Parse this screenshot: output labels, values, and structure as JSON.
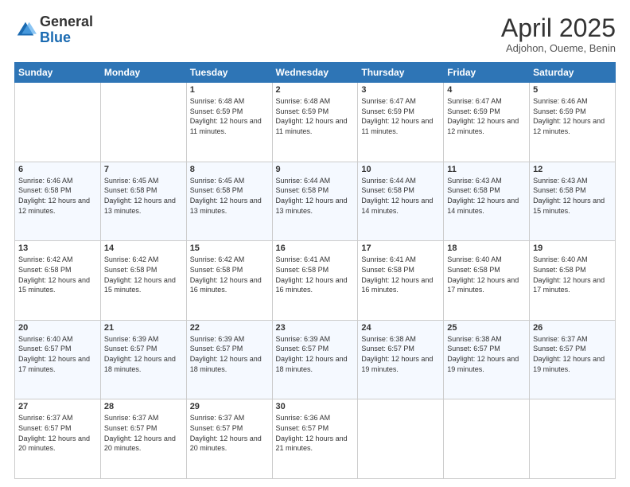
{
  "header": {
    "logo_general": "General",
    "logo_blue": "Blue",
    "month_title": "April 2025",
    "location": "Adjohon, Oueme, Benin"
  },
  "weekdays": [
    "Sunday",
    "Monday",
    "Tuesday",
    "Wednesday",
    "Thursday",
    "Friday",
    "Saturday"
  ],
  "weeks": [
    [
      {
        "day": "",
        "info": ""
      },
      {
        "day": "",
        "info": ""
      },
      {
        "day": "1",
        "info": "Sunrise: 6:48 AM\nSunset: 6:59 PM\nDaylight: 12 hours and 11 minutes."
      },
      {
        "day": "2",
        "info": "Sunrise: 6:48 AM\nSunset: 6:59 PM\nDaylight: 12 hours and 11 minutes."
      },
      {
        "day": "3",
        "info": "Sunrise: 6:47 AM\nSunset: 6:59 PM\nDaylight: 12 hours and 11 minutes."
      },
      {
        "day": "4",
        "info": "Sunrise: 6:47 AM\nSunset: 6:59 PM\nDaylight: 12 hours and 12 minutes."
      },
      {
        "day": "5",
        "info": "Sunrise: 6:46 AM\nSunset: 6:59 PM\nDaylight: 12 hours and 12 minutes."
      }
    ],
    [
      {
        "day": "6",
        "info": "Sunrise: 6:46 AM\nSunset: 6:58 PM\nDaylight: 12 hours and 12 minutes."
      },
      {
        "day": "7",
        "info": "Sunrise: 6:45 AM\nSunset: 6:58 PM\nDaylight: 12 hours and 13 minutes."
      },
      {
        "day": "8",
        "info": "Sunrise: 6:45 AM\nSunset: 6:58 PM\nDaylight: 12 hours and 13 minutes."
      },
      {
        "day": "9",
        "info": "Sunrise: 6:44 AM\nSunset: 6:58 PM\nDaylight: 12 hours and 13 minutes."
      },
      {
        "day": "10",
        "info": "Sunrise: 6:44 AM\nSunset: 6:58 PM\nDaylight: 12 hours and 14 minutes."
      },
      {
        "day": "11",
        "info": "Sunrise: 6:43 AM\nSunset: 6:58 PM\nDaylight: 12 hours and 14 minutes."
      },
      {
        "day": "12",
        "info": "Sunrise: 6:43 AM\nSunset: 6:58 PM\nDaylight: 12 hours and 15 minutes."
      }
    ],
    [
      {
        "day": "13",
        "info": "Sunrise: 6:42 AM\nSunset: 6:58 PM\nDaylight: 12 hours and 15 minutes."
      },
      {
        "day": "14",
        "info": "Sunrise: 6:42 AM\nSunset: 6:58 PM\nDaylight: 12 hours and 15 minutes."
      },
      {
        "day": "15",
        "info": "Sunrise: 6:42 AM\nSunset: 6:58 PM\nDaylight: 12 hours and 16 minutes."
      },
      {
        "day": "16",
        "info": "Sunrise: 6:41 AM\nSunset: 6:58 PM\nDaylight: 12 hours and 16 minutes."
      },
      {
        "day": "17",
        "info": "Sunrise: 6:41 AM\nSunset: 6:58 PM\nDaylight: 12 hours and 16 minutes."
      },
      {
        "day": "18",
        "info": "Sunrise: 6:40 AM\nSunset: 6:58 PM\nDaylight: 12 hours and 17 minutes."
      },
      {
        "day": "19",
        "info": "Sunrise: 6:40 AM\nSunset: 6:58 PM\nDaylight: 12 hours and 17 minutes."
      }
    ],
    [
      {
        "day": "20",
        "info": "Sunrise: 6:40 AM\nSunset: 6:57 PM\nDaylight: 12 hours and 17 minutes."
      },
      {
        "day": "21",
        "info": "Sunrise: 6:39 AM\nSunset: 6:57 PM\nDaylight: 12 hours and 18 minutes."
      },
      {
        "day": "22",
        "info": "Sunrise: 6:39 AM\nSunset: 6:57 PM\nDaylight: 12 hours and 18 minutes."
      },
      {
        "day": "23",
        "info": "Sunrise: 6:39 AM\nSunset: 6:57 PM\nDaylight: 12 hours and 18 minutes."
      },
      {
        "day": "24",
        "info": "Sunrise: 6:38 AM\nSunset: 6:57 PM\nDaylight: 12 hours and 19 minutes."
      },
      {
        "day": "25",
        "info": "Sunrise: 6:38 AM\nSunset: 6:57 PM\nDaylight: 12 hours and 19 minutes."
      },
      {
        "day": "26",
        "info": "Sunrise: 6:37 AM\nSunset: 6:57 PM\nDaylight: 12 hours and 19 minutes."
      }
    ],
    [
      {
        "day": "27",
        "info": "Sunrise: 6:37 AM\nSunset: 6:57 PM\nDaylight: 12 hours and 20 minutes."
      },
      {
        "day": "28",
        "info": "Sunrise: 6:37 AM\nSunset: 6:57 PM\nDaylight: 12 hours and 20 minutes."
      },
      {
        "day": "29",
        "info": "Sunrise: 6:37 AM\nSunset: 6:57 PM\nDaylight: 12 hours and 20 minutes."
      },
      {
        "day": "30",
        "info": "Sunrise: 6:36 AM\nSunset: 6:57 PM\nDaylight: 12 hours and 21 minutes."
      },
      {
        "day": "",
        "info": ""
      },
      {
        "day": "",
        "info": ""
      },
      {
        "day": "",
        "info": ""
      }
    ]
  ]
}
